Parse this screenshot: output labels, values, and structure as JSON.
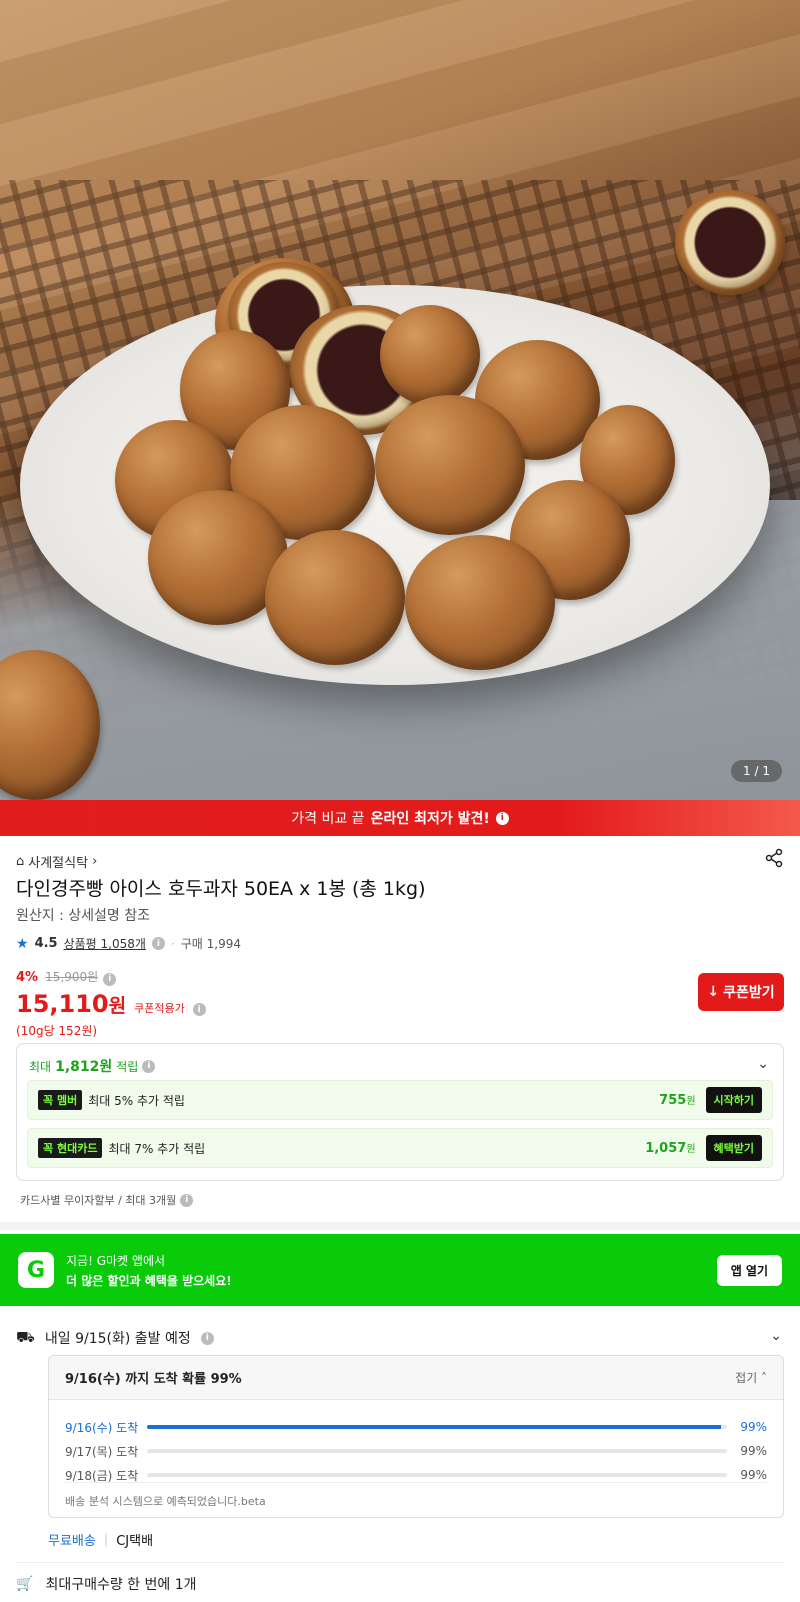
{
  "gallery": {
    "counter": "1 / 1"
  },
  "promo_banner": {
    "prefix": "가격 비교 끝",
    "highlight": "온라인 최저가 발견!"
  },
  "product": {
    "category": "사계절식탁",
    "title": "다인경주빵 아이스 호두과자 50EA x 1봉 (총 1kg)",
    "origin": "원산지 : 상세설명 참조",
    "rating": "4.5",
    "reviews": "상품평 1,058개",
    "purchases": "구매 1,994"
  },
  "price": {
    "discount": "4%",
    "original": "15,900원",
    "final": "15,110",
    "currency": "원",
    "coupon_note": "쿠폰적용가",
    "unit_price": "(10g당 152원)",
    "coupon_button": "쿠폰받기"
  },
  "rewards": {
    "prefix": "최대",
    "amount": "1,812원",
    "suffix": "적립",
    "rows": [
      {
        "tag": "멤버",
        "text": "최대 5% 추가 적립",
        "amount": "755",
        "unit": "원",
        "button": "시작하기"
      },
      {
        "tag": "현대카드",
        "text": "최대 7% 추가 적립",
        "amount": "1,057",
        "unit": "원",
        "button": "혜택받기"
      }
    ]
  },
  "installment": "카드사별 무이자할부 / 최대 3개월",
  "app_banner": {
    "logo": "G",
    "line1": "지금! G마켓 앱에서",
    "line2": "더 많은 할인과 혜택을 받으세요!",
    "button": "앱 열기"
  },
  "shipping": {
    "departure": "내일 9/15(화) 출발 예정",
    "eta_title": "9/16(수) 까지 도착 확률 99%",
    "fold": "접기",
    "rows": [
      {
        "label": "9/16(수) 도착",
        "value": 99,
        "pct": "99%"
      },
      {
        "label": "9/17(목) 도착",
        "value": 0,
        "pct": "99%"
      },
      {
        "label": "9/18(금) 도착",
        "value": 0,
        "pct": "99%"
      }
    ],
    "note": "배송 분석 시스템으로 예측되었습니다.beta",
    "free": "무료배송",
    "carrier": "CJ택배",
    "max_buy": "최대구매수량 한 번에 1개"
  },
  "colors": {
    "accent_red": "#e31a1a",
    "gmarket_green": "#0acb0a",
    "eta_blue": "#1a6fd6"
  }
}
